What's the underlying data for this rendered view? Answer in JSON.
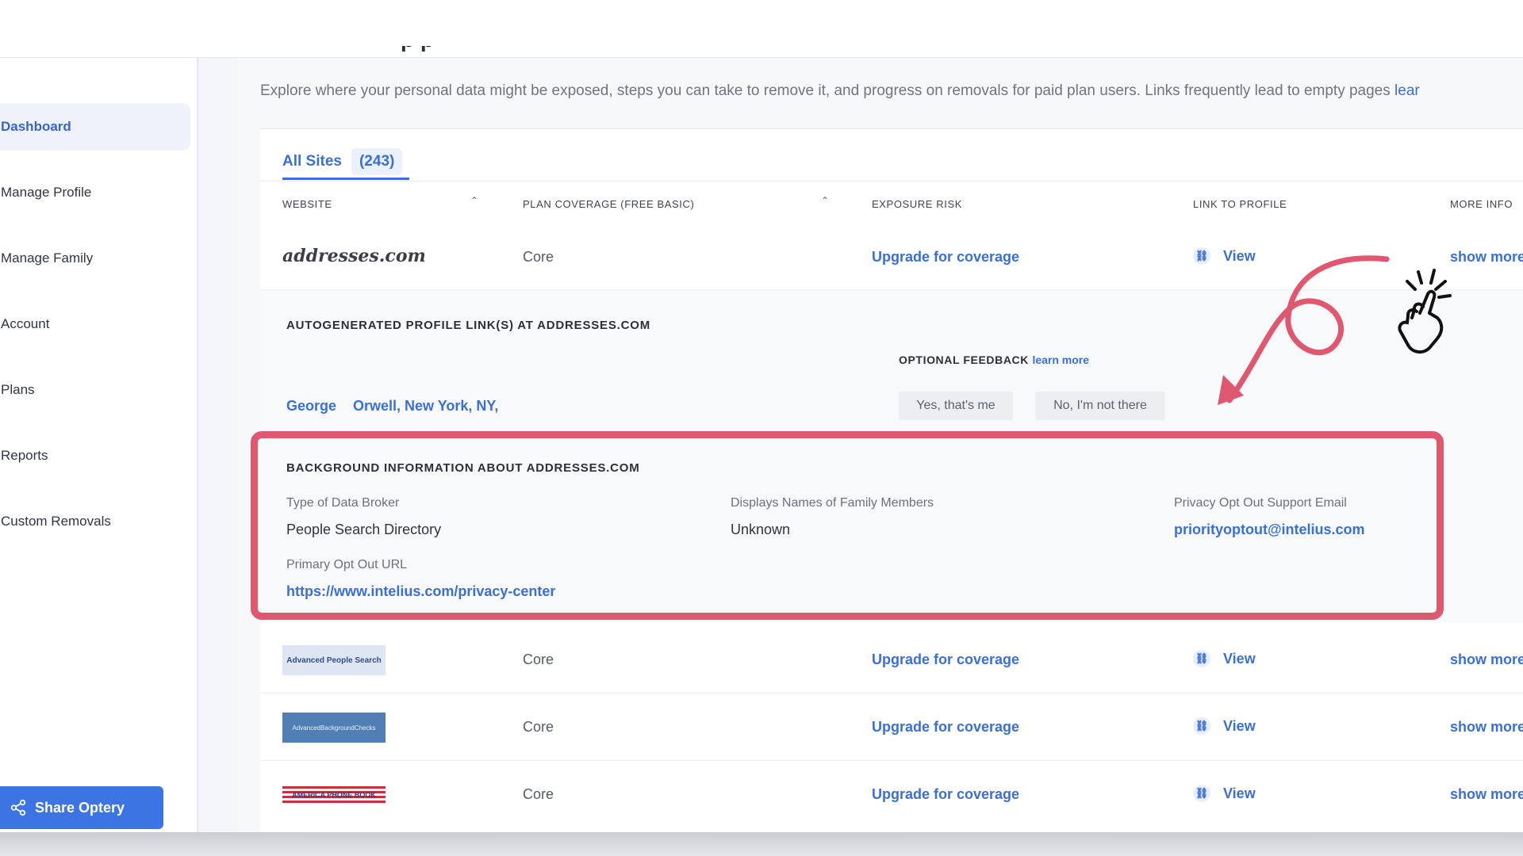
{
  "sidebar": {
    "items": [
      {
        "label": "Dashboard",
        "active": true
      },
      {
        "label": "Manage Profile"
      },
      {
        "label": "Manage Family"
      },
      {
        "label": "Account"
      },
      {
        "label": "Plans"
      },
      {
        "label": "Reports"
      },
      {
        "label": "Custom Removals"
      }
    ],
    "share_label": "Share Optery"
  },
  "page": {
    "description": "Explore where your personal data might be exposed, steps you can take to remove it, and progress on removals for paid plan users. Links frequently lead to empty pages",
    "learn_link": "lear"
  },
  "tabs": {
    "label": "All Sites",
    "count": "(243)"
  },
  "table": {
    "headers": {
      "website": "WEBSITE",
      "plan": "PLAN COVERAGE (FREE BASIC)",
      "risk": "EXPOSURE RISK",
      "link": "LINK TO PROFILE",
      "more": "MORE INFO"
    },
    "rows": [
      {
        "site": "addresses.com",
        "coverage": "Core",
        "risk": "Upgrade for coverage",
        "link": "View",
        "more": "show more"
      },
      {
        "site": "Advanced People Search",
        "coverage": "Core",
        "risk": "Upgrade for coverage",
        "link": "View",
        "more": "show more"
      },
      {
        "site": "AdvancedBackgroundChecks",
        "coverage": "Core",
        "risk": "Upgrade for coverage",
        "link": "View",
        "more": "show more"
      },
      {
        "site": "AMERICA PHONE BOOK",
        "coverage": "Core",
        "risk": "Upgrade for coverage",
        "link": "View",
        "more": "show more"
      }
    ]
  },
  "expanded": {
    "profile_heading": "AUTOGENERATED PROFILE LINK(S) AT ADDRESSES.COM",
    "feedback_label": "OPTIONAL FEEDBACK",
    "feedback_link": "learn more",
    "profile_first": "George",
    "profile_rest": "Orwell, New York, NY,",
    "yes_btn": "Yes, that's me",
    "no_btn": "No, I'm not there",
    "bg_heading": "BACKGROUND INFORMATION ABOUT ADDRESSES.COM",
    "type_label": "Type of Data Broker",
    "type_value": "People Search Directory",
    "family_label": "Displays Names of Family Members",
    "family_value": "Unknown",
    "email_label": "Privacy Opt Out Support Email",
    "email_value": "priorityoptout@intelius.com",
    "url_label": "Primary Opt Out URL",
    "url_value": "https://www.intelius.com/privacy-center"
  },
  "colors": {
    "accent": "#3a6fd8",
    "highlight": "#e0586f",
    "share": "#3d74e4"
  },
  "icons": [
    "share-icon",
    "link-icon",
    "sort-up-icon",
    "hand-tap-icon",
    "arrow-annotation-icon"
  ]
}
